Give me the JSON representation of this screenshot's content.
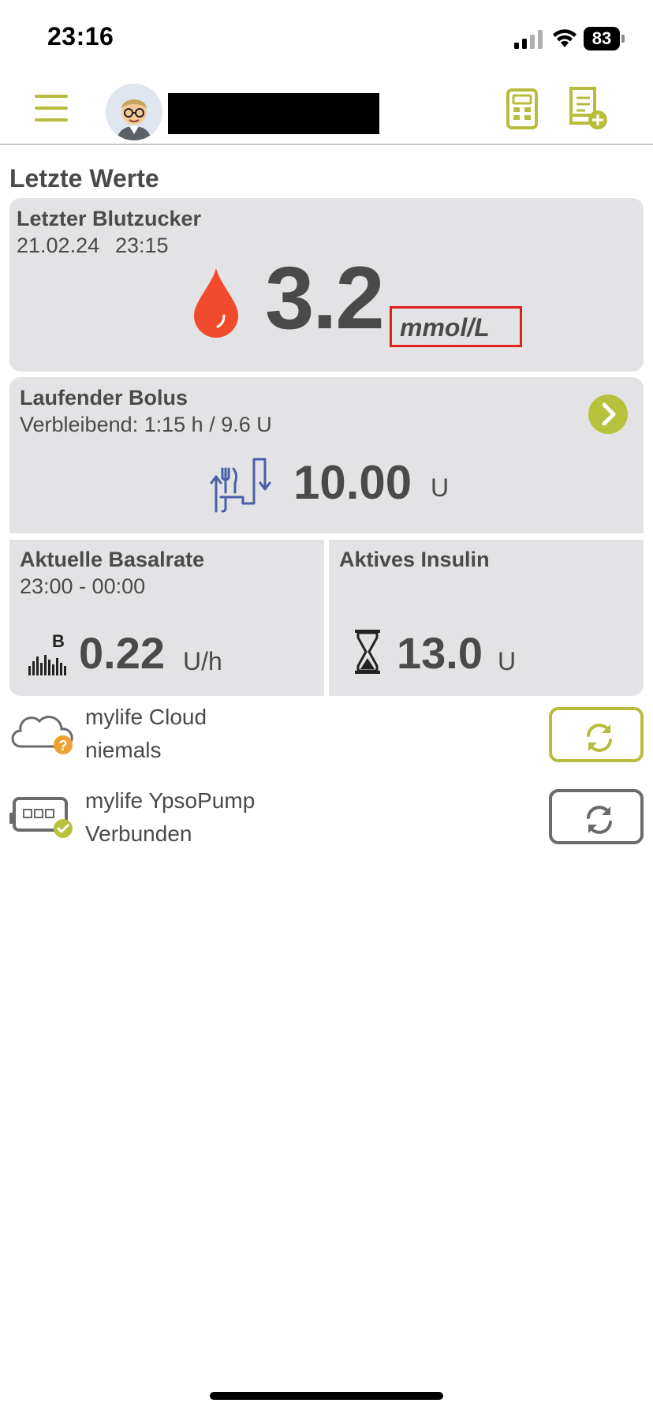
{
  "status_bar": {
    "time": "23:16",
    "battery": "83"
  },
  "header": {
    "menu_icon": "hamburger-menu-icon",
    "avatar_icon": "user-avatar",
    "calculator_icon": "bolus-calculator-icon",
    "report_icon": "add-logbook-entry-icon"
  },
  "section_title": "Letzte Werte",
  "blood_glucose": {
    "title": "Letzter Blutzucker",
    "date": "21.02.24",
    "time": "23:15",
    "value": "3.2",
    "unit": "mmol/L",
    "drop_color": "#f24a2c"
  },
  "bolus": {
    "title": "Laufender Bolus",
    "remaining": "Verbleibend: 1:15 h /  9.6 U",
    "value": "10.00",
    "unit": "U"
  },
  "basal": {
    "title": "Aktuelle Basalrate",
    "time_range": "23:00 - 00:00",
    "value": "0.22",
    "unit": "U/h",
    "icon_label": "B"
  },
  "active_insulin": {
    "title": "Aktives Insulin",
    "value": "13.0",
    "unit": "U"
  },
  "devices": [
    {
      "name": "mylife Cloud",
      "status": "niemals",
      "icon": "cloud-warning-icon"
    },
    {
      "name": "mylife YpsoPump",
      "status": "Verbunden",
      "icon": "pump-connected-icon"
    }
  ],
  "colors": {
    "accent": "#b7bc3c",
    "card": "#e3e3e5",
    "text": "#4a4a4a",
    "highlight_box": "#e02020",
    "bolus_icon": "#4a5fa8"
  }
}
